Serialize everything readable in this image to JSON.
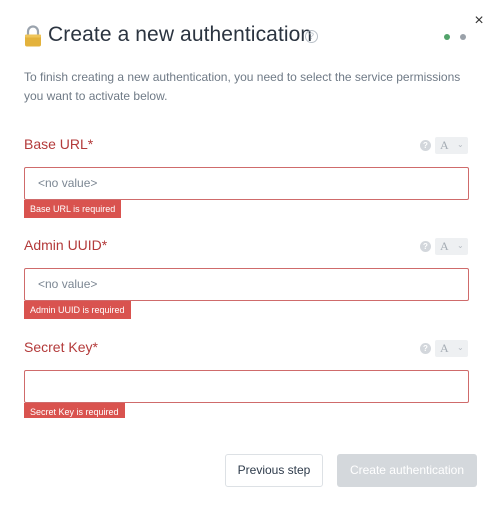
{
  "dialog": {
    "title": "Create a new authentication",
    "close_glyph": "×",
    "help_glyph": "?",
    "intro": "To finish creating a new authentication, you need to select the service permissions you want to activate below.",
    "steps": {
      "current": 1,
      "total": 2
    },
    "icons": {
      "title_icon": "lock-icon",
      "close": "close-icon",
      "help": "help-icon"
    }
  },
  "fields": [
    {
      "label": "Base URL*",
      "value": "",
      "placeholder": "<no value>",
      "error": "Base URL is required",
      "mode": "A"
    },
    {
      "label": "Admin UUID*",
      "value": "",
      "placeholder": "<no value>",
      "error": "Admin UUID is required",
      "mode": "A"
    },
    {
      "label": "Secret Key*",
      "value": "",
      "placeholder": "",
      "error": "Secret Key is required",
      "mode": "A"
    }
  ],
  "field_help_glyph": "?",
  "mode_chevron_glyph": "⌄",
  "footer": {
    "previous_label": "Previous step",
    "create_label": "Create authentication",
    "create_enabled": false
  },
  "colors": {
    "error": "#d9534f",
    "label_error": "#b33a3a",
    "step_active": "#52a36a",
    "step_inactive": "#9aa1a9",
    "disabled_button": "#d4d8dc"
  }
}
